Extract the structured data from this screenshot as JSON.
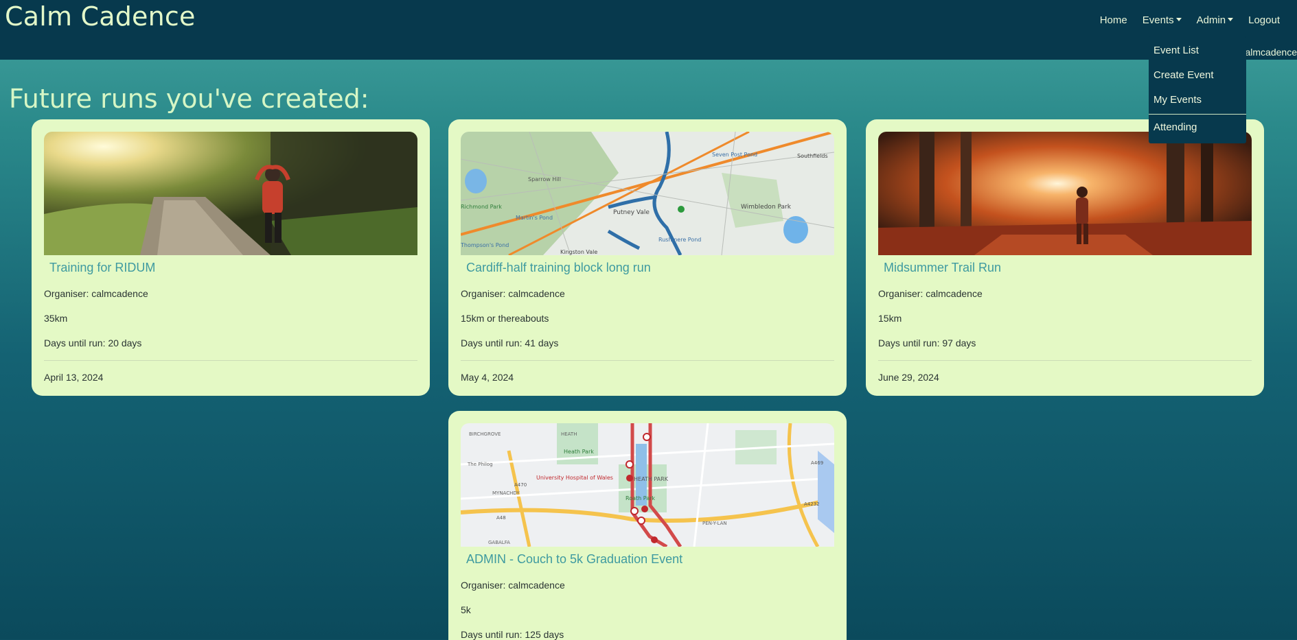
{
  "app": {
    "brand": "Calm Cadence",
    "user": "calmcadence"
  },
  "nav": {
    "home": "Home",
    "events": "Events",
    "admin": "Admin",
    "logout": "Logout"
  },
  "events_menu": {
    "items": [
      "Event List",
      "Create Event",
      "My Events",
      "Attending"
    ]
  },
  "page": {
    "title": "Future runs you've created:"
  },
  "cards": [
    {
      "title": "Training for RIDUM",
      "organiser": "Organiser: calmcadence",
      "distance": "35km",
      "days": "Days until run: 20 days",
      "date": "April 13, 2024",
      "image": "sunny-path-runner-photo"
    },
    {
      "title": "Cardiff-half training block long run",
      "organiser": "Organiser: calmcadence",
      "distance": "15km or thereabouts",
      "days": "Days until run: 41 days",
      "date": "May 4, 2024",
      "image": "route-map",
      "map_labels": [
        "Sparrow Hill",
        "Martin's Pond",
        "Putney Vale",
        "Wimbledon Park",
        "Southfields",
        "Rushmere Pond",
        "Kingston Vale",
        "Thompson's Pond",
        "Seven Post Pond",
        "Richmond Park"
      ]
    },
    {
      "title": "Midsummer Trail Run",
      "organiser": "Organiser: calmcadence",
      "distance": "15km",
      "days": "Days until run: 97 days",
      "date": "June 29, 2024",
      "image": "autumn-forest-runner-photo"
    },
    {
      "title": "ADMIN - Couch to 5k Graduation Event",
      "organiser": "Organiser: calmcadence",
      "distance": "5k",
      "days": "Days until run: 125 days",
      "image": "route-map",
      "map_labels": [
        "BIRCHGROVE",
        "HEATH",
        "Heath Park",
        "The Philog",
        "University Hospital of Wales",
        "MYNACHDY",
        "HEATH PARK",
        "Roath Park",
        "PEN-Y-LAN",
        "GABALFA",
        "A48",
        "A470",
        "A4232",
        "A469"
      ]
    }
  ],
  "colors": {
    "topbar": "#07394d",
    "card_bg": "#e4f9c5",
    "title_link": "#3e9aa0",
    "heading": "#d6f6c5"
  }
}
